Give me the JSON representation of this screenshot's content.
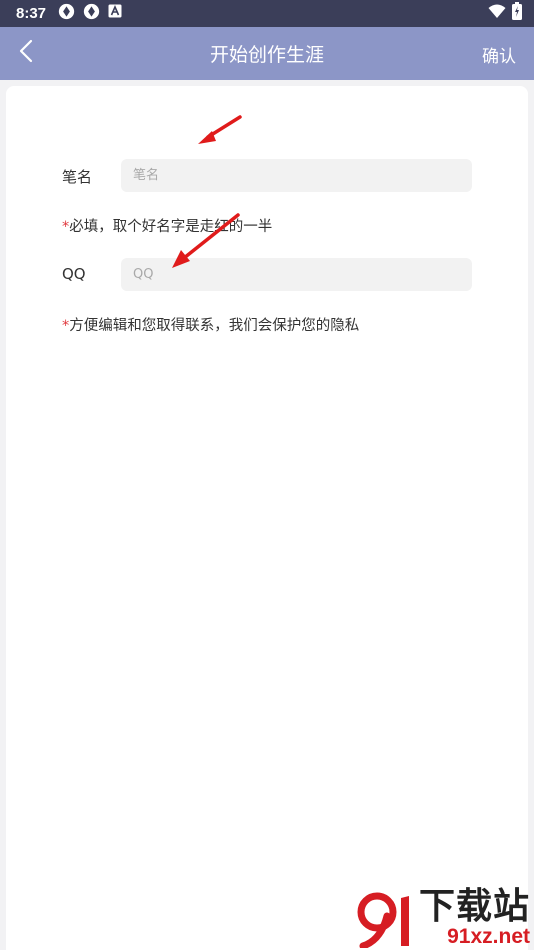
{
  "status_bar": {
    "time": "8:37",
    "left_icons": [
      "aperture-icon",
      "aperture-icon",
      "text-a-icon"
    ],
    "right_icons": [
      "wifi-icon",
      "battery-charging-icon"
    ]
  },
  "app_bar": {
    "back_icon": "chevron-left-icon",
    "title": "开始创作生涯",
    "confirm_label": "确认",
    "background": "#8c96c7"
  },
  "form": {
    "pen_name": {
      "label": "笔名",
      "value": "",
      "placeholder": "笔名",
      "hint_mark": "*",
      "hint": "必填，取个好名字是走红的一半"
    },
    "qq": {
      "label": "QQ",
      "value": "",
      "placeholder": "QQ",
      "hint_mark": "*",
      "hint": "方便编辑和您取得联系，我们会保护您的隐私"
    }
  },
  "colors": {
    "status_bar": "#3b3e59",
    "required_mark": "#e0393e",
    "annotation_arrow": "#e01b1b"
  },
  "watermark": {
    "logo_text": "下载站",
    "site": "91xz.net"
  }
}
